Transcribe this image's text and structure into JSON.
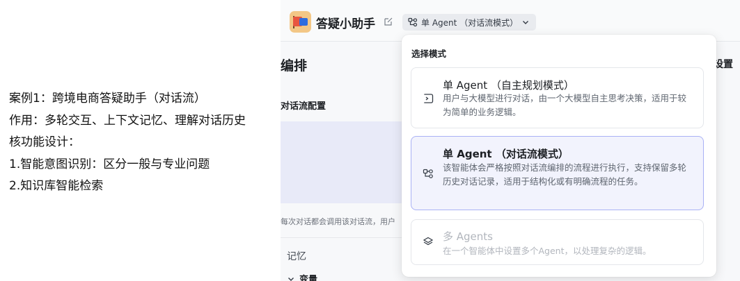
{
  "notes": {
    "lines": [
      "案例1：跨境电商答疑助手（对话流）",
      "作用：多轮交互、上下文记忆、理解对话历史",
      "核功能设计：",
      "1.智能意图识别：区分一般与专业问题",
      "2.知识库智能检索"
    ]
  },
  "topbar": {
    "bot_name": "答疑小助手",
    "mode_label": "单 Agent （对话流模式）",
    "icons": [
      "bot-avatar",
      "edit-icon",
      "workflow-icon",
      "chevron-down-icon"
    ]
  },
  "main": {
    "section_title": "编排",
    "flow_config_label": "对话流配置",
    "flow_hint": "每次对话都会调用该对话流，用户",
    "memory_label": "记忆",
    "variable_label": "变量",
    "settings_partial": "设置"
  },
  "dropdown": {
    "title": "选择模式",
    "options": [
      {
        "title": "单 Agent （自主规划模式）",
        "desc": "用户与大模型进行对话，由一个大模型自主思考决策，适用于较为简单的业务逻辑。",
        "icon": "agent-terminal-icon",
        "selected": false,
        "disabled": false
      },
      {
        "title": "单 Agent （对话流模式）",
        "desc": "该智能体会严格按照对话流编排的流程进行执行，支持保留多轮历史对话记录，适用于结构化或有明确流程的任务。",
        "icon": "workflow-icon",
        "selected": true,
        "disabled": false
      },
      {
        "title": "多 Agents",
        "desc": "在一个智能体中设置多个Agent，以处理复杂的逻辑。",
        "icon": "layers-icon",
        "selected": false,
        "disabled": true
      }
    ]
  },
  "colors": {
    "accent": "#a9b1f5",
    "selected_bg": "#f2f3fd",
    "flow_box_bg": "#e8eaf8"
  }
}
